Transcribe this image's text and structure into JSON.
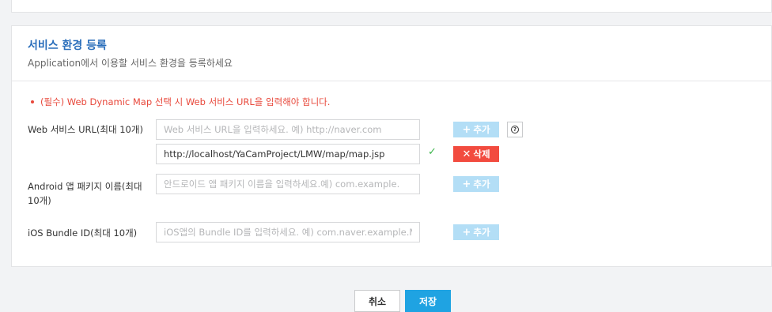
{
  "section": {
    "title": "서비스 환경 등록",
    "description": "Application에서 이용할 서비스 환경을 등록하세요",
    "notice": "(필수) Web Dynamic Map 선택 시 Web 서비스 URL을 입력해야 합니다."
  },
  "web": {
    "label": "Web 서비스 URL(최대 10개)",
    "placeholder": "Web 서비스 URL을 입력하세요. 예) http://naver.com",
    "entries": [
      {
        "value": "http://localhost/YaCamProject/LMW/map/map.jsp",
        "status_icon": "check-icon"
      }
    ],
    "add_label": "추가",
    "delete_label": "삭제",
    "help_icon": "question-circle-icon"
  },
  "android": {
    "label": "Android 앱 패키지 이름(최대 10개)",
    "placeholder": "안드로이드 앱 패키지 이름을 입력하세요.예) com.example.",
    "add_label": "추가"
  },
  "ios": {
    "label": "iOS Bundle ID(최대 10개)",
    "placeholder": "iOS앱의 Bundle ID를 입력하세요. 예) com.naver.example.My",
    "add_label": "추가"
  },
  "footer": {
    "cancel_label": "취소",
    "save_label": "저장"
  },
  "colors": {
    "title": "#2a6ebb",
    "notice": "#e8483b",
    "add_button": "#b3def6",
    "delete_button": "#f24b3f",
    "save_button": "#1fa3e2",
    "check": "#3bb54a"
  }
}
